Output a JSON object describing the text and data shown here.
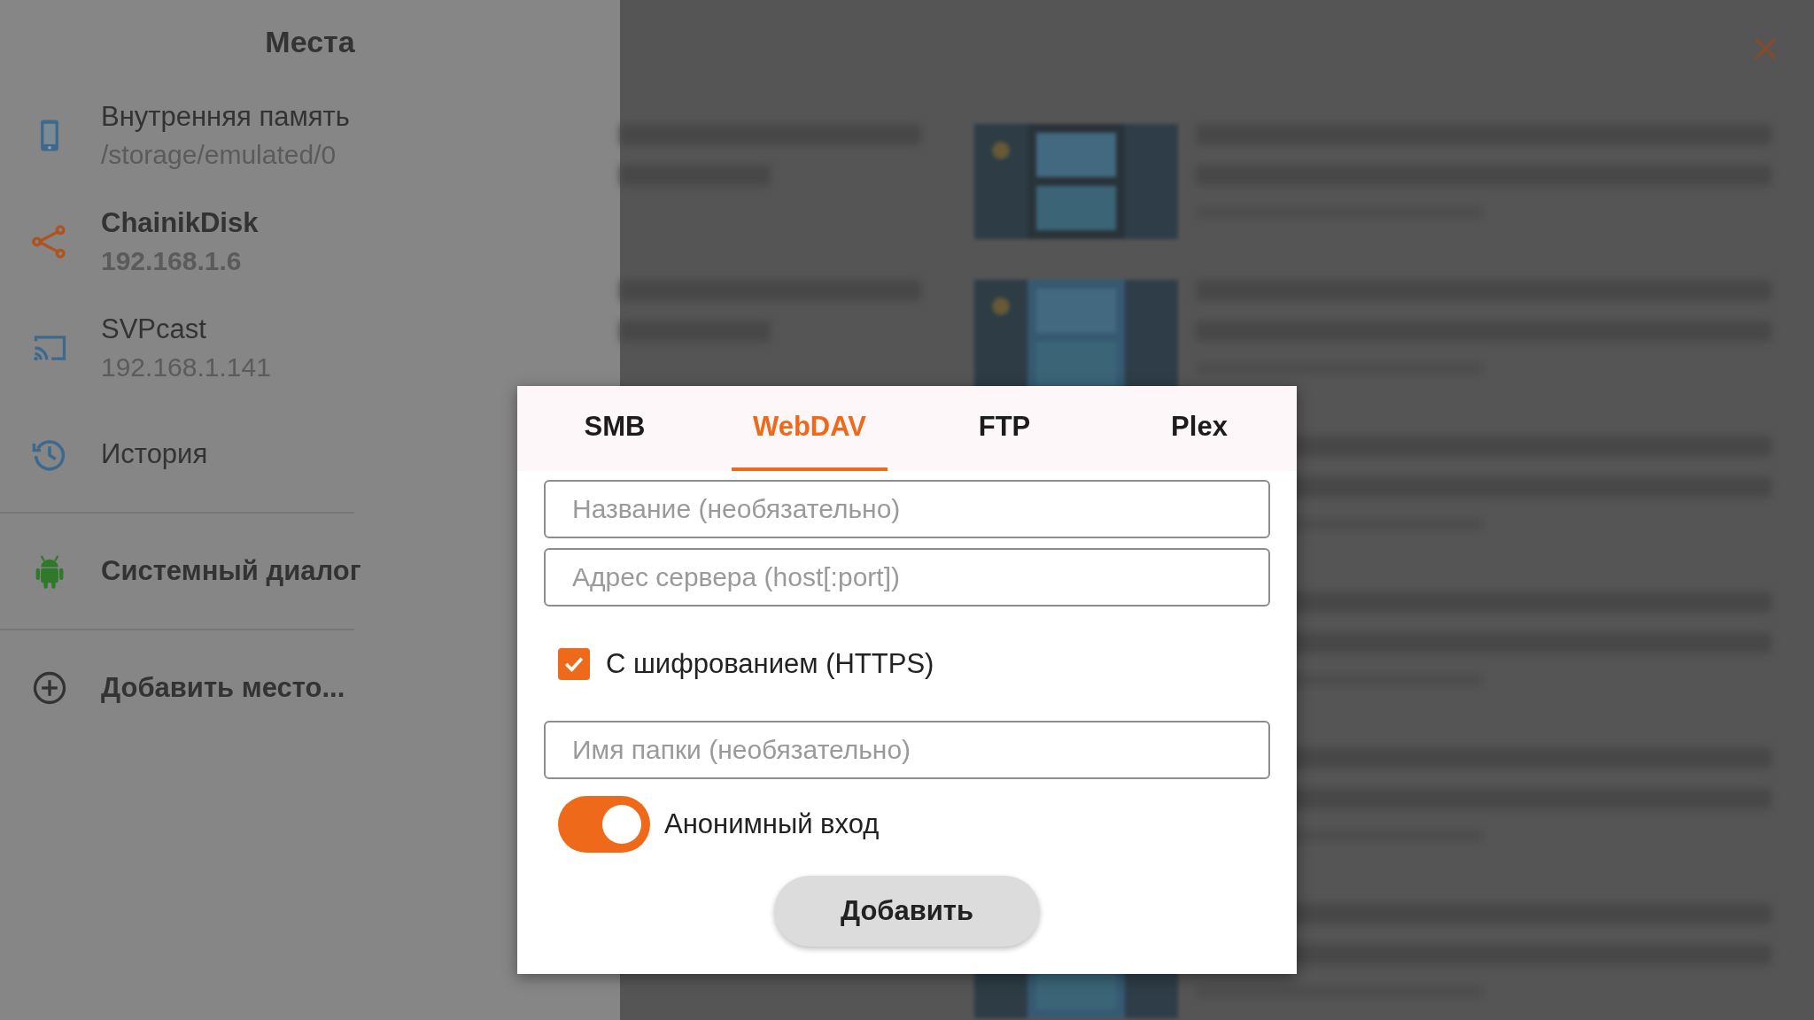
{
  "sidebar": {
    "title": "Места",
    "groups": [
      [
        {
          "kind": "device",
          "title": "Внутренняя память",
          "subtitle": "/storage/emulated/0",
          "bold": false
        },
        {
          "kind": "network",
          "title": "ChainikDisk",
          "subtitle": "192.168.1.6",
          "bold": true
        },
        {
          "kind": "cast",
          "title": "SVPcast",
          "subtitle": "192.168.1.141",
          "bold": false
        },
        {
          "kind": "history",
          "title": "История",
          "bold": false
        }
      ],
      [
        {
          "kind": "system",
          "title": "Системный диалог",
          "bold": true
        }
      ],
      [
        {
          "kind": "add",
          "title": "Добавить место...",
          "bold": true
        }
      ]
    ]
  },
  "dialog": {
    "tabs": [
      {
        "label": "SMB",
        "selected": false
      },
      {
        "label": "WebDAV",
        "selected": true
      },
      {
        "label": "FTP",
        "selected": false
      },
      {
        "label": "Plex",
        "selected": false
      }
    ],
    "controls": [
      {
        "kind": "field",
        "placeholder": "Название (необязательно)"
      },
      {
        "kind": "field",
        "placeholder": "Адрес сервера (host[:port])"
      },
      {
        "kind": "checkbox",
        "label": "С шифрованием (HTTPS)",
        "checked": true
      },
      {
        "kind": "field",
        "placeholder": "Имя папки (необязательно)"
      },
      {
        "kind": "switch",
        "label": "Анонимный вход",
        "on": true
      }
    ],
    "button": "Добавить"
  }
}
